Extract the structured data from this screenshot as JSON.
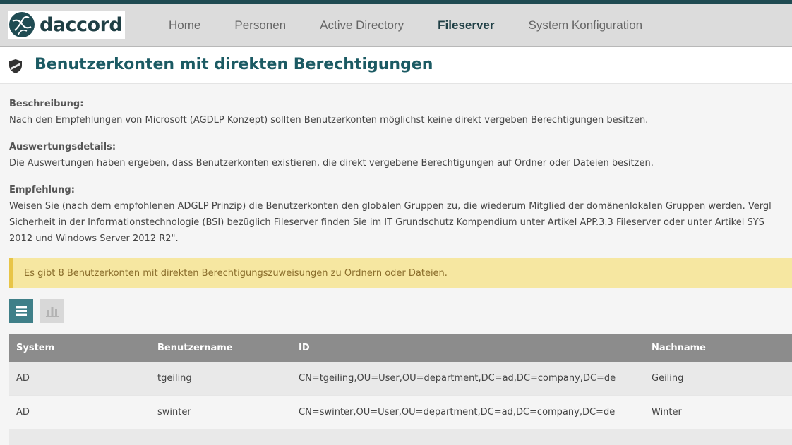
{
  "app": {
    "logo_text": "daccord"
  },
  "nav": {
    "items": [
      {
        "label": "Home"
      },
      {
        "label": "Personen"
      },
      {
        "label": "Active Directory"
      },
      {
        "label": "Fileserver",
        "active": true
      },
      {
        "label": "System Konfiguration"
      }
    ]
  },
  "page": {
    "title": "Benutzerkonten mit direkten Berechtigungen",
    "title_icon": "shield-icon"
  },
  "sections": {
    "beschreibung_label": "Beschreibung:",
    "beschreibung_text": "Nach den Empfehlungen von Microsoft (AGDLP Konzept) sollten Benutzerkonten möglichst keine direkt vergeben Berechtigungen besitzen.",
    "details_label": "Auswertungsdetails:",
    "details_text": "Die Auswertungen haben ergeben, dass Benutzerkonten existieren, die direkt vergebene Berechtigungen auf Ordner oder Dateien besitzen.",
    "empfehlung_label": "Empfehlung:",
    "empfehlung_line1": "Weisen Sie (nach dem empfohlenen ADGLP Prinzip) die Benutzerkonten den globalen Gruppen zu, die wiederum Mitglied der domänenlokalen Gruppen werden. Vergl",
    "empfehlung_line2": "Sicherheit in der Informationstechnologie (BSI) bezüglich Fileserver finden Sie im IT Grundschutz Kompendium unter Artikel APP.3.3 Fileserver oder unter Artikel SYS",
    "empfehlung_line3": "2012 und Windows Server 2012 R2\"."
  },
  "alert": {
    "text": "Es gibt 8 Benutzerkonten mit direkten Berechtigungszuweisungen zu Ordnern oder Dateien."
  },
  "view_toggle": {
    "list_icon": "list-icon",
    "chart_icon": "bar-chart-icon",
    "active": "list"
  },
  "table": {
    "headers": [
      "System",
      "Benutzername",
      "ID",
      "Nachname"
    ],
    "rows": [
      [
        "AD",
        "tgeiling",
        "CN=tgeiling,OU=User,OU=department,DC=ad,DC=company,DC=de",
        "Geiling"
      ],
      [
        "AD",
        "swinter",
        "CN=swinter,OU=User,OU=department,DC=ad,DC=company,DC=de",
        "Winter"
      ]
    ]
  },
  "colors": {
    "brand_dark": "#1f4b52",
    "title": "#1b5a63",
    "alert_bg": "#f6e7a1",
    "alert_border": "#e8c547",
    "table_header": "#8c8c8c"
  }
}
